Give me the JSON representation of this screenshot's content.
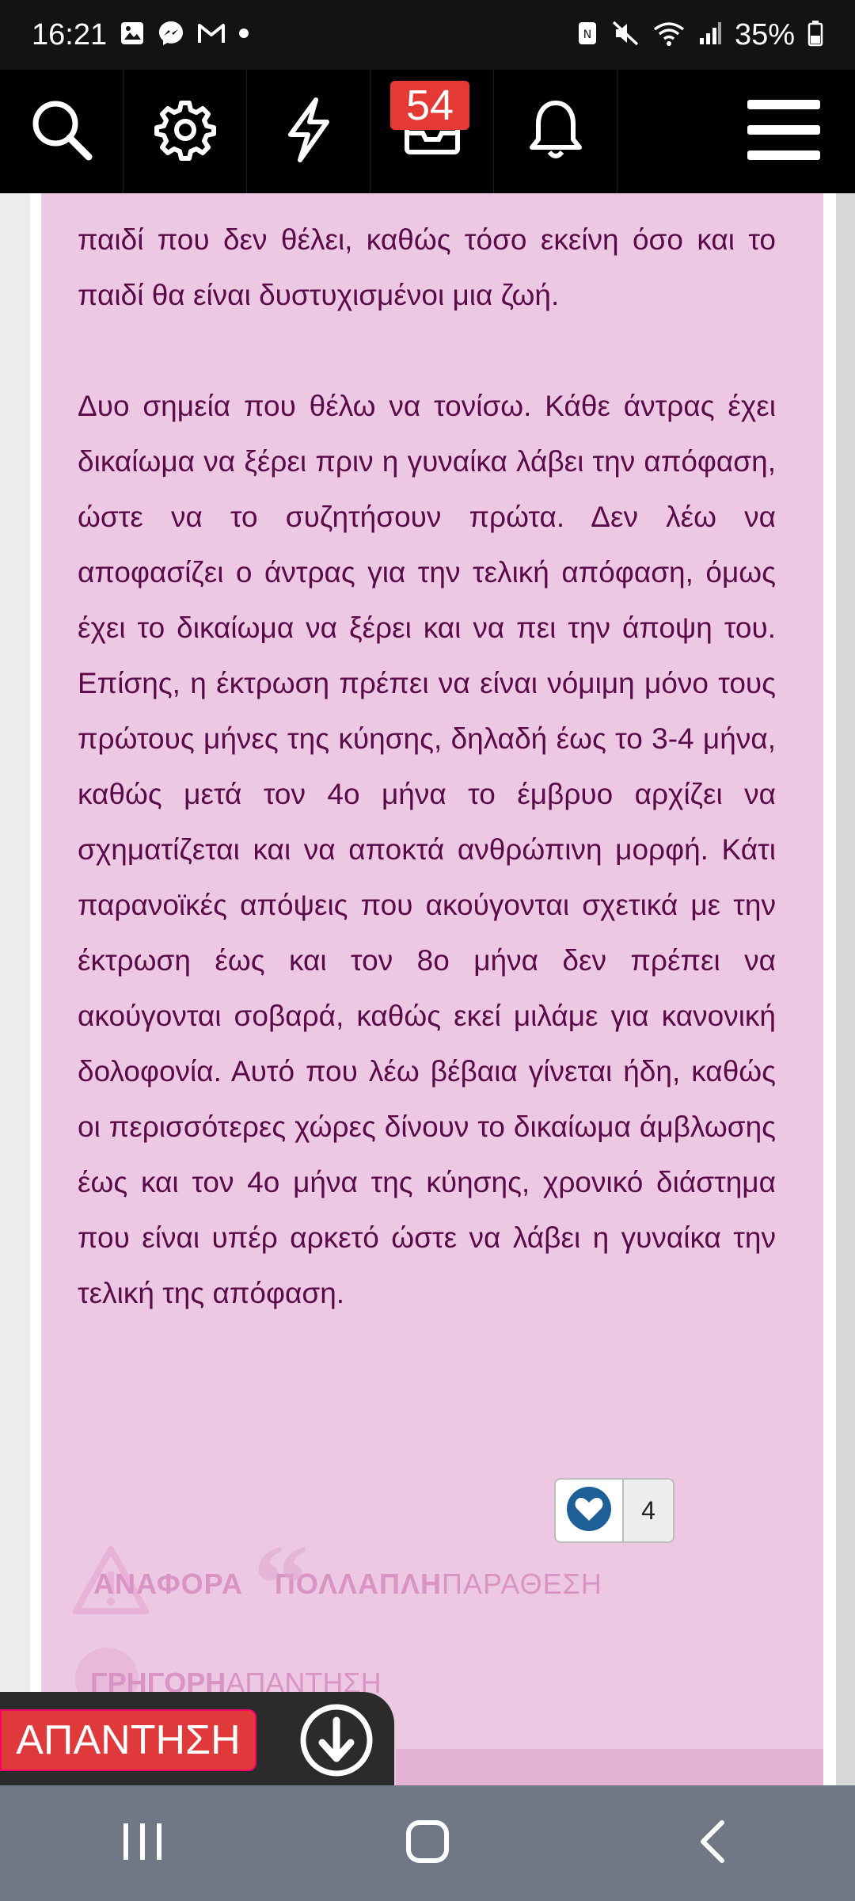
{
  "status_bar": {
    "time": "16:21",
    "battery": "35%",
    "left_icons": [
      "gallery-icon",
      "messenger-icon",
      "gmail-icon",
      "dot-icon"
    ],
    "right_icons": [
      "nfc-icon",
      "mute-icon",
      "wifi-icon",
      "signal-icon",
      "battery-icon"
    ]
  },
  "toolbar": {
    "notification_count": "54",
    "icons": [
      "search-icon",
      "gear-icon",
      "lightning-icon",
      "inbox-icon",
      "bell-icon",
      "menu-icon"
    ]
  },
  "post": {
    "para1": "παιδί που δεν θέλει, καθώς τόσο εκείνη όσο και το παιδί θα είναι δυστυχισμένοι μια ζωή.",
    "para2": "Δυο σημεία που θέλω να τονίσω. Κάθε άντρας έχει δικαίωμα να ξέρει πριν η γυναίκα λάβει την απόφαση, ώστε να το συζητήσουν πρώτα. Δεν λέω να αποφασίζει ο άντρας για την τελική απόφαση, όμως έχει το δικαίωμα να ξέρει και να πει την άποψη του. Επίσης, η έκτρωση πρέπει να είναι νόμιμη μόνο τους πρώτους μήνες της κύησης, δηλαδή έως το 3-4 μήνα, καθώς μετά τον 4ο μήνα το έμβρυο αρχίζει να σχηματίζεται και να αποκτά ανθρώπινη μορφή. Κάτι παρανοϊκές απόψεις που ακούγονται σχετικά με την έκτρωση έως και τον 8ο μήνα δεν πρέπει να ακούγονται σοβαρά, καθώς εκεί μιλάμε για κανονική δολοφονία. Αυτό που λέω βέβαια γίνεται ήδη, καθώς οι περισσότερες χώρες δίνουν το δικαίωμα άμβλωσης έως και τον 4ο μήνα της κύησης, χρονικό διάστημα που είναι υπέρ αρκετό ώστε να λάβει η γυναίκα την τελική της απόφαση.",
    "like_count": "4"
  },
  "actions": {
    "report_label": "ΑΝΑΦΟΡΑ",
    "multi_bold": "ΠΟΛΛΑΠΛΗ",
    "multi_light": "ΠΑΡΑΘΕΣΗ",
    "quick_bold": "ΓΡΗΓΟΡΗ",
    "quick_light": "ΑΠΑΝΤΗΣΗ",
    "reply_button": "ΑΠΑΝΤΗΣΗ"
  },
  "colors": {
    "post_bg": "#ecc8e2",
    "post_text": "#5a0a4a",
    "accent_red": "#e0393b"
  }
}
